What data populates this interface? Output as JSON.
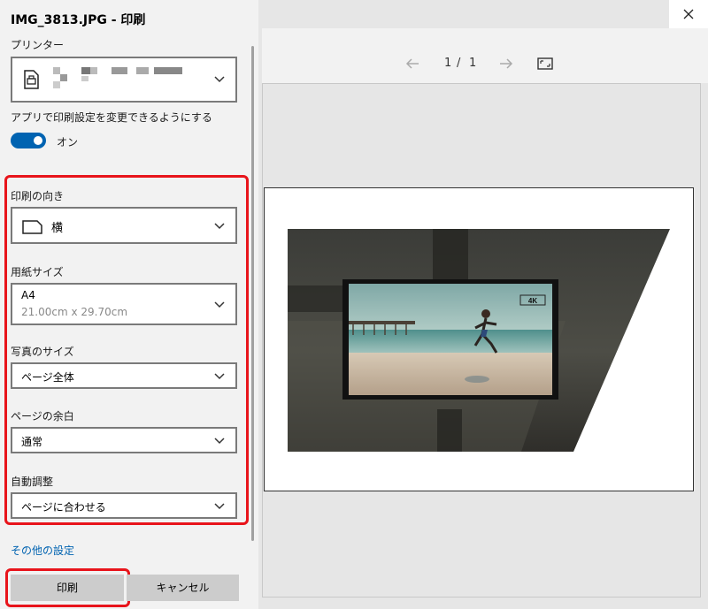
{
  "window": {
    "title": "IMG_3813.JPG - 印刷"
  },
  "printer": {
    "label": "プリンター"
  },
  "app_settings": {
    "label": "アプリで印刷設定を変更できるようにする",
    "toggle_state": "オン"
  },
  "orientation": {
    "label": "印刷の向き",
    "value": "横"
  },
  "paper_size": {
    "label": "用紙サイズ",
    "value": "A4",
    "sub": "21.00cm x 29.70cm"
  },
  "photo_size": {
    "label": "写真のサイズ",
    "value": "ページ全体"
  },
  "margins": {
    "label": "ページの余白",
    "value": "通常"
  },
  "fit": {
    "label": "自動調整",
    "value": "ページに合わせる"
  },
  "more_settings": "その他の設定",
  "buttons": {
    "print": "印刷",
    "cancel": "キャンセル"
  },
  "preview": {
    "page_current": "1",
    "page_separator": "/",
    "page_total": "1",
    "badge": "4K"
  },
  "colors": {
    "accent": "#0063b1",
    "highlight": "#e8141b"
  }
}
